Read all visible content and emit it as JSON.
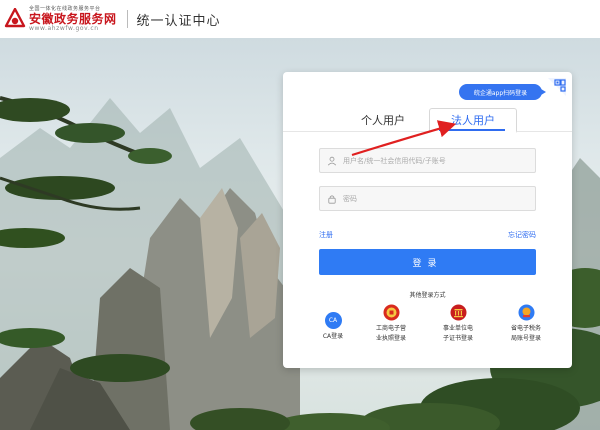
{
  "header": {
    "logo_sub": "全国一体化在线政务服务平台",
    "logo_main": "安徽政务服务网",
    "logo_url": "www.ahzwfw.gov.cn",
    "title": "统一认证中心"
  },
  "card": {
    "app_tip": "皖企通app扫码登录",
    "tabs": [
      {
        "label": "个人用户",
        "active": false
      },
      {
        "label": "法人用户",
        "active": true
      }
    ],
    "username_placeholder": "用户名/统一社会信用代码/子账号",
    "password_placeholder": "密码",
    "register_label": "注册",
    "forgot_label": "忘记密码",
    "login_label": "登录",
    "other_title": "其他登录方式",
    "other_options": [
      {
        "line1": "CA登录",
        "line2": ""
      },
      {
        "line1": "工商电子营",
        "line2": "业执照登录"
      },
      {
        "line1": "事业单位电",
        "line2": "子证书登录"
      },
      {
        "line1": "省电子税务",
        "line2": "局账号登录"
      }
    ],
    "ca_icon_text": "CA"
  },
  "colors": {
    "accent": "#2f7bf4",
    "brand_red": "#c8161d"
  },
  "icons": [
    "logo-icon",
    "qr-code-icon",
    "user-icon",
    "lock-icon",
    "ca-icon",
    "business-license-icon",
    "institution-icon",
    "tax-bureau-icon"
  ]
}
